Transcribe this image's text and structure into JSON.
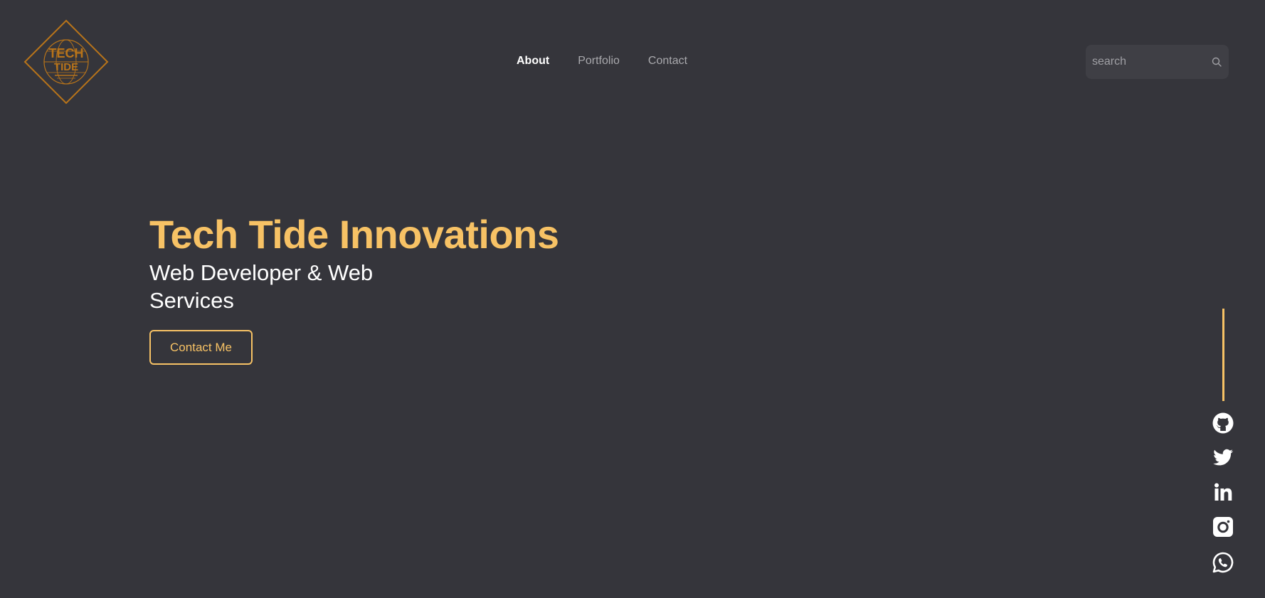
{
  "brand": {
    "logo_icon": "tech-tide-diamond-logo",
    "logo_line1": "TECH",
    "logo_line2": "TIDE",
    "logo_color": "#b8741a"
  },
  "nav": {
    "items": [
      {
        "label": "About",
        "active": true
      },
      {
        "label": "Portfolio",
        "active": false
      },
      {
        "label": "Contact",
        "active": false
      }
    ]
  },
  "search": {
    "placeholder": "search",
    "value": "",
    "icon": "search-icon"
  },
  "hero": {
    "title": "Tech Tide Innovations",
    "subtitle": "Web Developer & Web Services",
    "cta_label": "Contact Me"
  },
  "social": {
    "icons": [
      "github-icon",
      "twitter-icon",
      "linkedin-icon",
      "instagram-icon",
      "whatsapp-icon"
    ]
  },
  "colors": {
    "background": "#35353b",
    "accent": "#f7c265",
    "nav_inactive": "#a9a9ad",
    "text_primary": "#ffffff"
  }
}
